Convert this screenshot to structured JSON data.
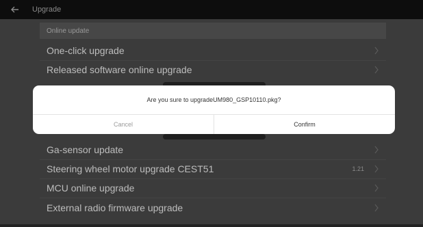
{
  "header": {
    "title": "Upgrade"
  },
  "section": {
    "label": "Online update"
  },
  "items": [
    {
      "label": "One-click upgrade",
      "value": ""
    },
    {
      "label": "Released software online upgrade",
      "value": ""
    },
    {
      "label": "Ga-sensor update",
      "value": ""
    },
    {
      "label": "Steering wheel motor upgrade CEST51",
      "value": "1.21"
    },
    {
      "label": "MCU online upgrade",
      "value": ""
    },
    {
      "label": "External radio firmware upgrade",
      "value": ""
    }
  ],
  "dialog": {
    "message": "Are you sure to upgradeUM980_GSP10110.pkg?",
    "cancel_label": "Cancel",
    "confirm_label": "Confirm"
  },
  "colors": {
    "topbar": "#0d0d0d",
    "background": "#3b3b3b",
    "dialog": "#ffffff"
  },
  "icons": {
    "back": "back-arrow-icon",
    "chevron": "chevron-right-icon"
  }
}
